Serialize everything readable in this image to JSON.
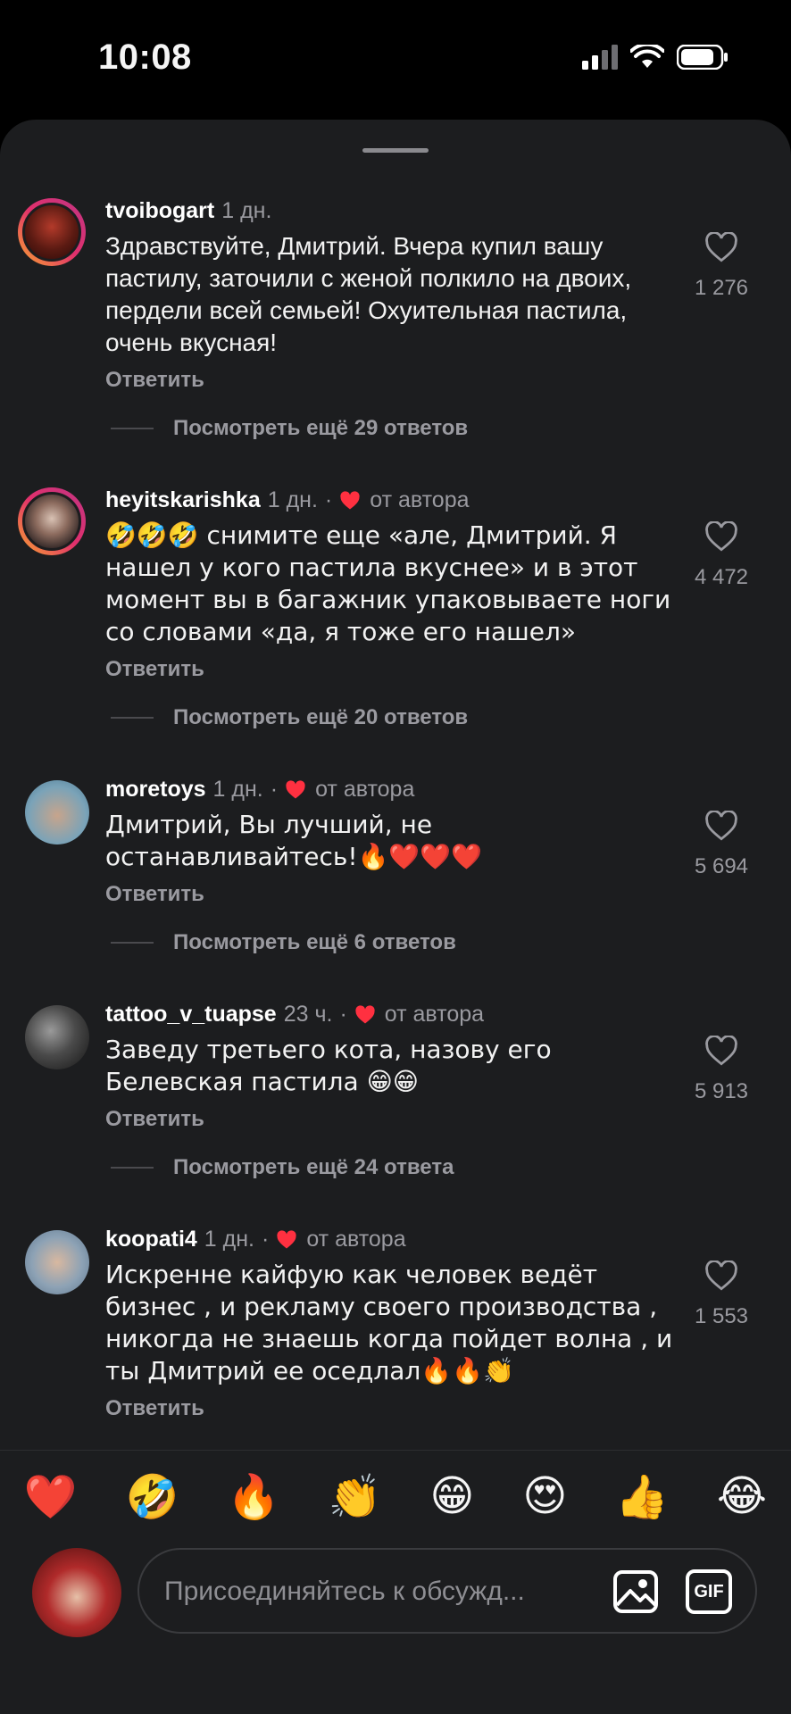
{
  "status": {
    "time": "10:08"
  },
  "reply_label": "Ответить",
  "comments": [
    {
      "username": "tvoibogart",
      "time": "1 дн.",
      "author_liked": false,
      "author_label": "",
      "text": "Здравствуйте, Дмитрий. Вчера купил вашу пастилу, заточили с женой полкило на двоих, пердели всей семьей! Охуительная пастила, очень вкусная!",
      "likes": "1 276",
      "more_replies": "Посмотреть ещё 29 ответов"
    },
    {
      "username": "heyitskarishka",
      "time": "1 дн.",
      "author_liked": true,
      "author_label": "от автора",
      "text": "🤣🤣🤣 снимите еще «але, Дмитрий. Я нашел у кого пастила вкуснее» и в этот момент вы в багажник упаковываете ноги со словами «да, я тоже его нашел»",
      "likes": "4 472",
      "more_replies": "Посмотреть ещё 20 ответов"
    },
    {
      "username": "moretoys",
      "time": "1 дн.",
      "author_liked": true,
      "author_label": "от автора",
      "text": "Дмитрий, Вы лучший, не останавливайтесь!🔥❤️❤️❤️",
      "likes": "5 694",
      "more_replies": "Посмотреть ещё 6 ответов"
    },
    {
      "username": "tattoo_v_tuapse",
      "time": "23 ч.",
      "author_liked": true,
      "author_label": "от автора",
      "text": "Заведу третьего кота, назову его Белевская пастила 😁😁",
      "likes": "5 913",
      "more_replies": "Посмотреть ещё 24 ответа"
    },
    {
      "username": "koopati4",
      "time": "1 дн.",
      "author_liked": true,
      "author_label": "от автора",
      "text": "Искренне кайфую как человек ведёт бизнес , и рекламу своего производства , никогда не знаешь когда пойдет волна , и ты Дмитрий ее оседлал🔥🔥👏",
      "likes": "1 553",
      "more_replies": ""
    }
  ],
  "emoji_bar": [
    "❤️",
    "🤣",
    "🔥",
    "👏",
    "😁",
    "😍",
    "👍",
    "😂"
  ],
  "composer": {
    "placeholder": "Присоединяйтесь к обсужд...",
    "gif_label": "GIF"
  },
  "colors": {
    "sheet_bg": "#1c1d1f",
    "secondary_text": "#9a9aa0",
    "author_heart": "#ff3040"
  }
}
